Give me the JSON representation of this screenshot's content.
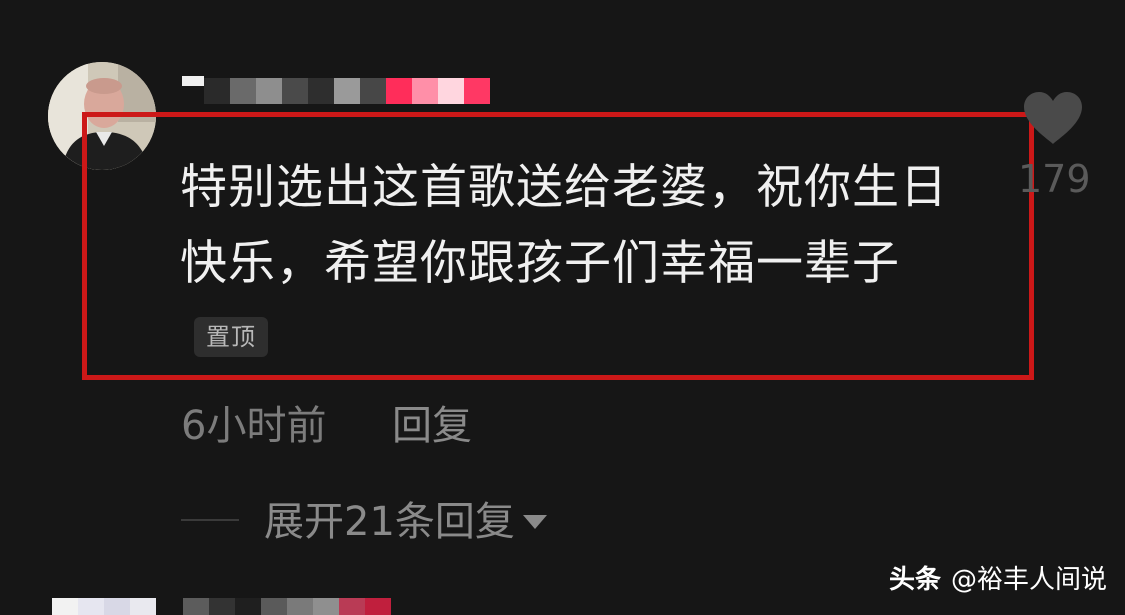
{
  "comment": {
    "text": "特别选出这首歌送给老婆，祝你生日快乐，希望你跟孩子们幸福一辈子",
    "pinned_label": "置顶",
    "time": "6小时前",
    "reply_label": "回复",
    "like_count": "179",
    "expand_replies_label": "展开21条回复",
    "username_pixel_colors": [
      "#2a2a2a",
      "#6a6a6a",
      "#8e8e8e",
      "#4a4a4a",
      "#2e2e2e",
      "#9a9a9a",
      "#474747",
      "#ff2d5a",
      "#ff8fa8",
      "#ffd6df",
      "#f5f5f5",
      "#ff3864"
    ]
  },
  "icons": {
    "like": "heart-icon",
    "expand": "triangle-down-icon",
    "avatar": "user-avatar"
  },
  "colors": {
    "background": "#161616",
    "highlight": "#cc1818",
    "text_primary": "#f0f0f0",
    "text_secondary": "#8a8a8a"
  },
  "watermark": {
    "brand": "头条",
    "handle": "@裕丰人间说"
  },
  "next_comment": {
    "avatar_pixel_colors": [
      "#f2f2f2",
      "#e6e6f0",
      "#d8d8e6",
      "#e9e9ef"
    ],
    "name_pixel_colors": [
      "#5c5c5c",
      "#333333",
      "#1f1f1f",
      "#5a5a5a",
      "#7a7a7a",
      "#8f8f8f",
      "#b93b55",
      "#c01f3d"
    ]
  }
}
